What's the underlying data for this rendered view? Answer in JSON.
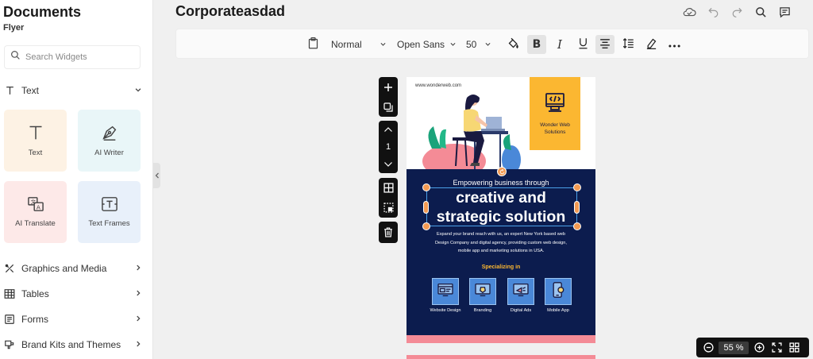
{
  "sidebar": {
    "title": "Documents",
    "subtitle": "Flyer",
    "search_placeholder": "Search Widgets",
    "text_section": {
      "label": "Text"
    },
    "tiles": [
      {
        "label": "Text",
        "icon": "text-icon"
      },
      {
        "label": "AI Writer",
        "icon": "pen-nib-icon"
      },
      {
        "label": "AI Translate",
        "icon": "translate-icon"
      },
      {
        "label": "Text Frames",
        "icon": "text-frame-icon"
      }
    ],
    "sections": [
      {
        "label": "Graphics and Media",
        "icon": "graphics-icon"
      },
      {
        "label": "Tables",
        "icon": "table-icon"
      },
      {
        "label": "Forms",
        "icon": "form-icon"
      },
      {
        "label": "Brand Kits and Themes",
        "icon": "brand-kit-icon"
      }
    ]
  },
  "header": {
    "doc_title": "Corporateasdad"
  },
  "toolbar": {
    "style": "Normal",
    "font": "Open Sans",
    "size": "50"
  },
  "canvas": {
    "page_number": "1"
  },
  "flyer": {
    "url": "www.wonderweb.com",
    "brand_name": "Wonder Web Solutions",
    "tagline": "Empowering business through",
    "headline_1": "creative and",
    "headline_2": "strategic solution",
    "body_1": "Expand your brand reach  with us, an expert New York based web",
    "body_2": "Design Company and digital agency, providing custom web design,",
    "body_3": "mobile app and marketing solutions in USA.",
    "specializing": "Specializing in",
    "services": [
      "Website Design",
      "Branding",
      "Digital Ads",
      "Mobile App"
    ],
    "colors": {
      "navy": "#0c1c4e",
      "yellow": "#fbb731",
      "pink": "#f48b96",
      "service_blue": "#4a88d8"
    }
  },
  "zoom": {
    "value": "55",
    "unit": "%"
  }
}
